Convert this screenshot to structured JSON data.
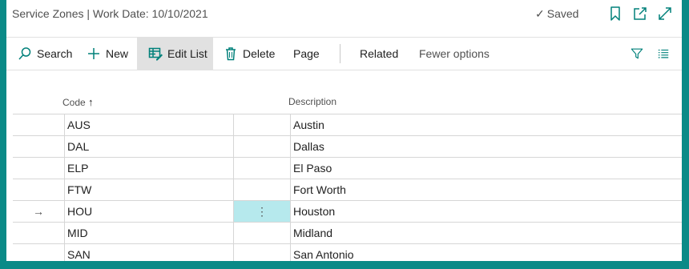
{
  "window": {
    "title": "Service Zones | Work Date: 10/10/2021",
    "saved_label": "Saved"
  },
  "actions": {
    "search": "Search",
    "new": "New",
    "edit_list": "Edit List",
    "delete": "Delete",
    "page": "Page",
    "related": "Related",
    "fewer_options": "Fewer options"
  },
  "columns": {
    "code": "Code",
    "code_sort": "↑",
    "description": "Description"
  },
  "rows": [
    {
      "code": "AUS",
      "description": "Austin",
      "selected": false
    },
    {
      "code": "DAL",
      "description": "Dallas",
      "selected": false
    },
    {
      "code": "ELP",
      "description": "El Paso",
      "selected": false
    },
    {
      "code": "FTW",
      "description": "Fort Worth",
      "selected": false
    },
    {
      "code": "HOU",
      "description": "Houston",
      "selected": true,
      "row_marker": "→",
      "menu": "⋮"
    },
    {
      "code": "MID",
      "description": "Midland",
      "selected": false
    },
    {
      "code": "SAN",
      "description": "San Antonio",
      "selected": false
    }
  ],
  "colors": {
    "background": "#0a8a87",
    "accent": "#00807a",
    "selected_cell": "#b6e9ed",
    "active_action": "#e1e1e1"
  },
  "icons": [
    "checkmark-icon",
    "bookmark-icon",
    "open-new-window-icon",
    "expand-icon",
    "search-icon",
    "plus-icon",
    "edit-list-icon",
    "trash-icon",
    "filter-icon",
    "list-view-icon",
    "arrow-right-icon",
    "more-vertical-icon"
  ]
}
